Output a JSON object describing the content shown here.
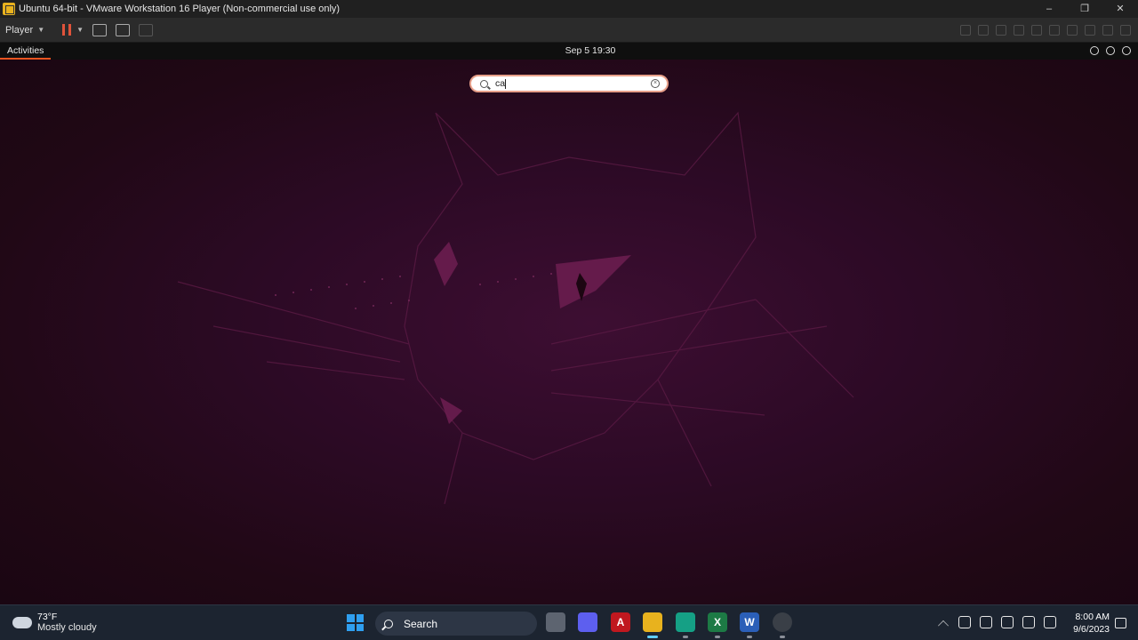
{
  "vmware": {
    "window_title": "Ubuntu 64-bit - VMware Workstation 16 Player (Non-commercial use only)",
    "controls": {
      "minimize": "–",
      "restore": "❐",
      "close": "✕"
    },
    "player_menu": "Player"
  },
  "ubuntu": {
    "activities": "Activities",
    "clock": "Sep 5  19:30",
    "search": {
      "value": "ca"
    }
  },
  "taskbar": {
    "weather": {
      "temp": "73°F",
      "condition": "Mostly cloudy"
    },
    "search_label": "Search",
    "time": "8:00 AM",
    "date": "9/6/2023",
    "apps": [
      {
        "name": "task-view",
        "color": "#5d6470"
      },
      {
        "name": "meet",
        "color": "#5d5fef"
      },
      {
        "name": "acrobat",
        "color": "#c0181f"
      },
      {
        "name": "vmware",
        "color": "#e8b21e"
      },
      {
        "name": "files",
        "color": "#15a085"
      },
      {
        "name": "excel",
        "color": "#1d7a45"
      },
      {
        "name": "word",
        "color": "#2b5fb8"
      },
      {
        "name": "browser",
        "color": "#3a3f47"
      }
    ]
  }
}
